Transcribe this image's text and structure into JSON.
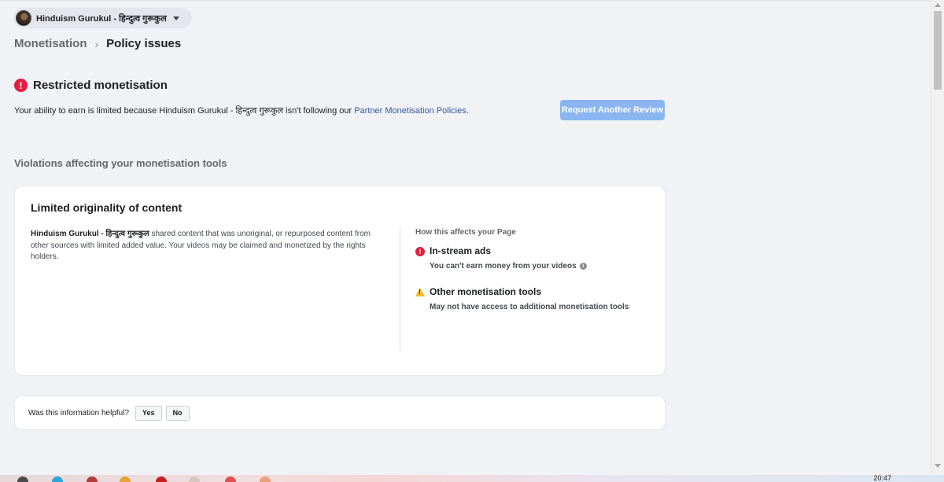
{
  "page_selector": {
    "name": "Hinduism Gurukul - हिन्दुत्व गुरूकुल"
  },
  "breadcrumb": {
    "parent": "Monetisation",
    "separator": "›",
    "current": "Policy issues"
  },
  "status": {
    "title": "Restricted monetisation",
    "desc_prefix": "Your ability to earn is limited because Hinduism Gurukul - हिन्दुत्व गुरूकुल isn't following our ",
    "desc_link": "Partner Monetisation Policies",
    "desc_suffix": ".",
    "review_button": "Request Another Review"
  },
  "violations": {
    "heading": "Violations affecting your monetisation tools",
    "card": {
      "title": "Limited originality of content",
      "page_name": "Hinduism Gurukul - हिन्दुत्व गुरूकुल",
      "description": " shared content that was unoriginal, or repurposed content from other sources with limited added value. Your videos may be claimed and monetized by the rights holders.",
      "affects_label": "How this affects your Page",
      "impacts": [
        {
          "title": "In-stream ads",
          "subtitle": "You can't earn money from your videos",
          "icon": "error-icon"
        },
        {
          "title": "Other monetisation tools",
          "subtitle": "May not have access to additional monetisation tools",
          "icon": "warning-icon"
        }
      ]
    }
  },
  "feedback": {
    "question": "Was this information helpful?",
    "yes": "Yes",
    "no": "No"
  },
  "taskbar": {
    "clock": "20:47"
  },
  "colors": {
    "background": "#f0f2f5",
    "error": "#e41e3f",
    "warning": "#f7b928",
    "link": "#385898",
    "button_disabled": "#8ab5f0"
  }
}
